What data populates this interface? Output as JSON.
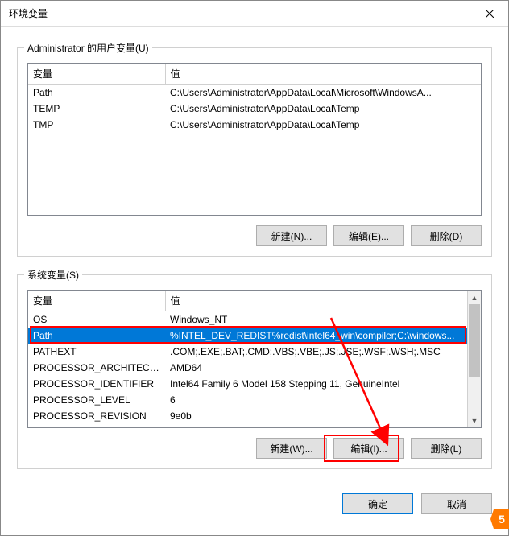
{
  "dialog": {
    "title": "环境变量",
    "close_tooltip": "关闭"
  },
  "userGroup": {
    "label": "Administrator 的用户变量(U)",
    "columns": {
      "var": "变量",
      "val": "值"
    },
    "rows": [
      {
        "var": "Path",
        "val": "C:\\Users\\Administrator\\AppData\\Local\\Microsoft\\WindowsA..."
      },
      {
        "var": "TEMP",
        "val": "C:\\Users\\Administrator\\AppData\\Local\\Temp"
      },
      {
        "var": "TMP",
        "val": "C:\\Users\\Administrator\\AppData\\Local\\Temp"
      }
    ],
    "buttons": {
      "new": "新建(N)...",
      "edit": "编辑(E)...",
      "del": "删除(D)"
    }
  },
  "sysGroup": {
    "label": "系统变量(S)",
    "columns": {
      "var": "变量",
      "val": "值"
    },
    "rows": [
      {
        "var": "OS",
        "val": "Windows_NT"
      },
      {
        "var": "Path",
        "val": "%INTEL_DEV_REDIST%redist\\intel64_win\\compiler;C:\\windows...",
        "selected": true
      },
      {
        "var": "PATHEXT",
        "val": ".COM;.EXE;.BAT;.CMD;.VBS;.VBE;.JS;.JSE;.WSF;.WSH;.MSC"
      },
      {
        "var": "PROCESSOR_ARCHITECT...",
        "val": "AMD64"
      },
      {
        "var": "PROCESSOR_IDENTIFIER",
        "val": "Intel64 Family 6 Model 158 Stepping 11, GenuineIntel"
      },
      {
        "var": "PROCESSOR_LEVEL",
        "val": "6"
      },
      {
        "var": "PROCESSOR_REVISION",
        "val": "9e0b"
      }
    ],
    "buttons": {
      "new": "新建(W)...",
      "edit": "编辑(I)...",
      "del": "删除(L)"
    }
  },
  "dialogButtons": {
    "ok": "确定",
    "cancel": "取消"
  }
}
